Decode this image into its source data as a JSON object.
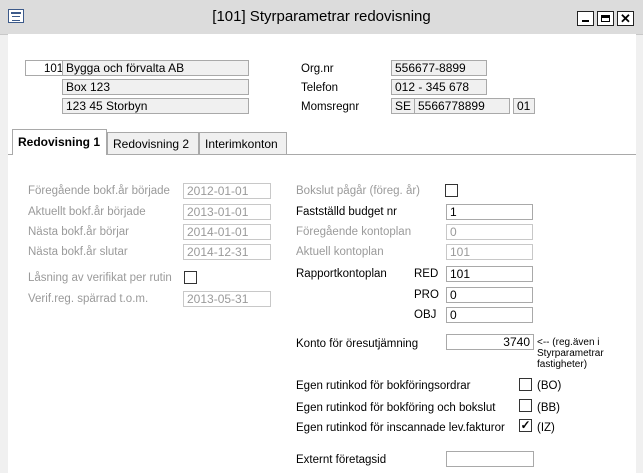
{
  "window": {
    "title": "[101]  Styrparametrar redovisning",
    "minimize_icon": "minimize-icon",
    "maximize_icon": "maximize-icon",
    "close_label": "✕"
  },
  "company": {
    "number": "101",
    "name": "Bygga och förvalta AB",
    "address": "Box 123",
    "postal": "123 45  Storbyn"
  },
  "org": {
    "orgnr_label": "Org.nr",
    "orgnr_value": "556677-8899",
    "phone_label": "Telefon",
    "phone_value": "012 - 345 678",
    "vat_label": "Momsregnr",
    "vat_country": "SE",
    "vat_number": "5566778899",
    "vat_suffix": "01"
  },
  "tabs": [
    {
      "label": "Redovisning 1"
    },
    {
      "label": "Redovisning 2"
    },
    {
      "label": "Interimkonton"
    }
  ],
  "left": {
    "prev_year_start_label": "Föregående bokf.år började",
    "prev_year_start": "2012-01-01",
    "cur_year_start_label": "Aktuellt bokf.år började",
    "cur_year_start": "2013-01-01",
    "next_year_start_label": "Nästa bokf.år börjar",
    "next_year_start": "2014-01-01",
    "next_year_end_label": "Nästa bokf.år slutar",
    "next_year_end": "2014-12-31",
    "lock_label": "Låsning av verifikat per rutin",
    "lock_checked": false,
    "locked_until_label": "Verif.reg. spärrad t.o.m.",
    "locked_until": "2013-05-31"
  },
  "right": {
    "closing_label": "Bokslut pågår (föreg. år)",
    "closing_checked": false,
    "budget_label": "Fastställd budget nr",
    "budget_value": "1",
    "prev_chart_label": "Föregående kontoplan",
    "prev_chart_value": "0",
    "cur_chart_label": "Aktuell kontoplan",
    "cur_chart_value": "101",
    "report_chart_label": "Rapportkontoplan",
    "red_label": "RED",
    "red_value": "101",
    "pro_label": "PRO",
    "pro_value": "0",
    "obj_label": "OBJ",
    "obj_value": "0",
    "rounding_label": "Konto för öresutjämning",
    "rounding_value": "3740",
    "rounding_note_1": "<-- (reg.även i",
    "rounding_note_2": "Styrparametrar",
    "rounding_note_3": "fastigheter)",
    "own_bo_label": "Egen rutinkod för bokföringsordrar",
    "own_bo_checked": false,
    "own_bo_code": "(BO)",
    "own_bb_label": "Egen rutinkod för bokföring och bokslut",
    "own_bb_checked": false,
    "own_bb_code": "(BB)",
    "own_iz_label": "Egen rutinkod för inscannade lev.fakturor",
    "own_iz_checked": true,
    "own_iz_code": "(IZ)",
    "external_id_label": "Externt företagsid",
    "external_id_value": ""
  }
}
